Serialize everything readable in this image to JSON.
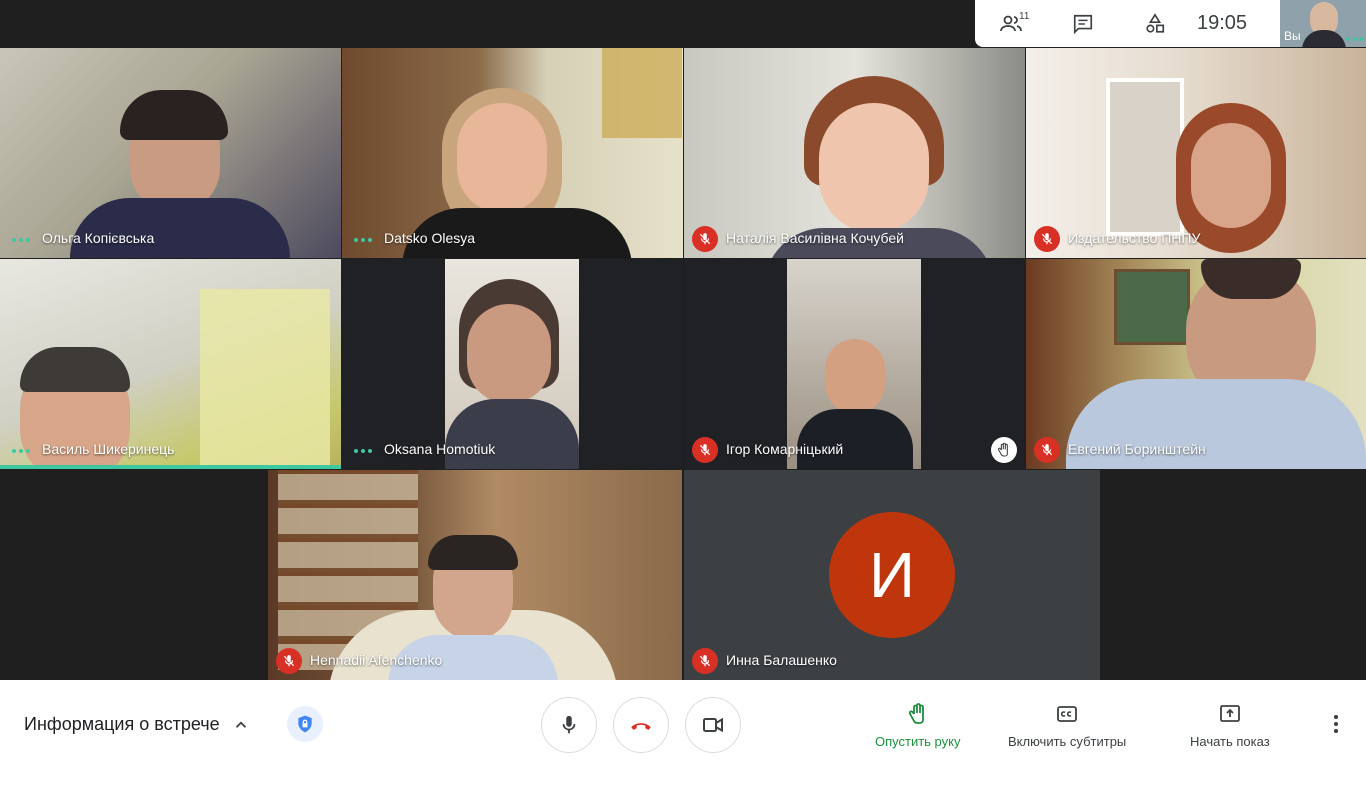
{
  "top_bar": {
    "participants_count": "11",
    "time": "19:05",
    "self_label": "Вы"
  },
  "tiles": [
    {
      "name": "Ольга Копієвська",
      "status": "speaking"
    },
    {
      "name": "Datsko Olesya",
      "status": "speaking"
    },
    {
      "name": "Наталія Василівна Кочубей",
      "status": "muted"
    },
    {
      "name": "Издательство ПНПУ",
      "status": "muted"
    },
    {
      "name": "Василь Шикеринець",
      "status": "speaking"
    },
    {
      "name": "Oksana Homotiuk",
      "status": "speaking"
    },
    {
      "name": "Ігор Комарніцький",
      "status": "muted"
    },
    {
      "name": "Евгений Боринштейн",
      "status": "muted"
    },
    {
      "name": "Hennadii Afenchenko",
      "status": "muted"
    },
    {
      "name": "Инна Балашенко",
      "status": "muted",
      "avatar_letter": "И",
      "avatar_color": "#bf360c"
    }
  ],
  "bottom_bar": {
    "meeting_info": "Информация о встрече",
    "lower_hand": "Опустить руку",
    "captions": "Включить субтитры",
    "present": "Начать показ"
  },
  "colors": {
    "accent_green": "#1e8e3e",
    "muted_red": "#d93025",
    "activity_teal": "#3ec8a2"
  }
}
